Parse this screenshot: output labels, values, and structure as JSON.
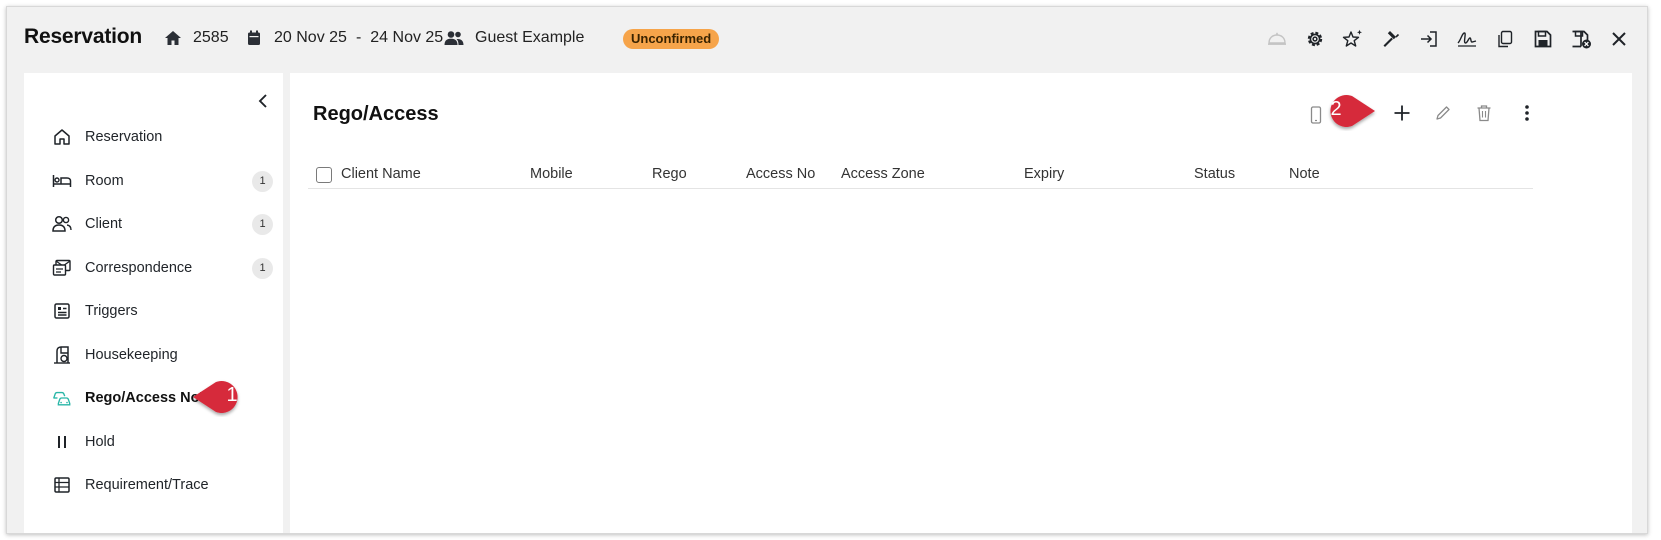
{
  "app": {
    "title": "Reservation",
    "reservation_id": "2585",
    "date_from": "20 Nov 25",
    "date_sep": "-",
    "date_to": "24 Nov 25",
    "guest": "Guest Example",
    "status": "Unconfirmed"
  },
  "colors": {
    "accent_teal": "#28b6a7",
    "badge": "#f6a44a",
    "callout": "#d62a3a"
  },
  "toolbar_icons": [
    "bell-icon",
    "gear-icon",
    "sparkle-star-icon",
    "hammer-icon",
    "check-in-icon",
    "signature-icon",
    "copy-icon",
    "save-icon",
    "save-close-icon",
    "close-icon"
  ],
  "sidebar": {
    "items": [
      {
        "label": "Reservation",
        "icon": "home-icon",
        "count": ""
      },
      {
        "label": "Room",
        "icon": "bed-icon",
        "count": "1"
      },
      {
        "label": "Client",
        "icon": "users-icon",
        "count": "1"
      },
      {
        "label": "Correspondence",
        "icon": "mail-icon",
        "count": "1"
      },
      {
        "label": "Triggers",
        "icon": "triggers-icon",
        "count": ""
      },
      {
        "label": "Housekeeping",
        "icon": "housekeeping-icon",
        "count": ""
      },
      {
        "label": "Rego/Access No's",
        "icon": "cars-icon",
        "count": ""
      },
      {
        "label": "Hold",
        "icon": "pause-icon",
        "count": ""
      },
      {
        "label": "Requirement/Trace",
        "icon": "list-icon",
        "count": ""
      }
    ]
  },
  "main": {
    "title": "Rego/Access",
    "columns": [
      "Client Name",
      "Mobile",
      "Rego",
      "Access No",
      "Access Zone",
      "Expiry",
      "Status",
      "Note"
    ],
    "rows": []
  },
  "callouts": [
    "1",
    "2"
  ]
}
